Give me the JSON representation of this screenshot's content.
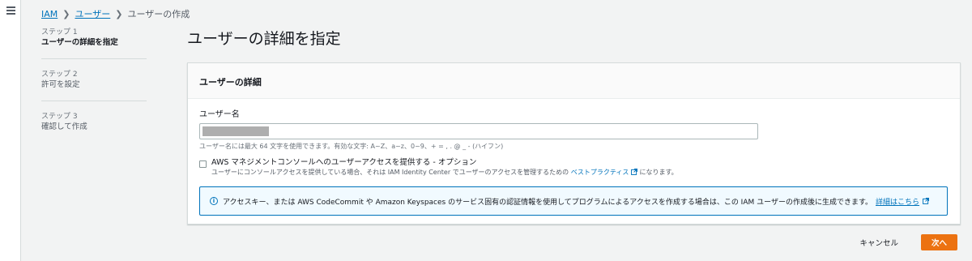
{
  "nav": {
    "menu_icon": "hamburger-menu-icon"
  },
  "breadcrumb": {
    "items": [
      "IAM",
      "ユーザー",
      "ユーザーの作成"
    ],
    "separator_icon": "chevron-right-icon"
  },
  "steps": [
    {
      "number": "ステップ 1",
      "title": "ユーザーの詳細を指定",
      "active": true
    },
    {
      "number": "ステップ 2",
      "title": "許可を設定",
      "active": false
    },
    {
      "number": "ステップ 3",
      "title": "確認して作成",
      "active": false
    }
  ],
  "page": {
    "title": "ユーザーの詳細を指定"
  },
  "panel": {
    "header": "ユーザーの詳細",
    "username_label": "ユーザー名",
    "username_value": "",
    "username_hint": "ユーザー名には最大 64 文字を使用できます。有効な文字: A~Z、a~z、0~9、+ = , . @ _ - (ハイフン)",
    "console_access": {
      "checked": false,
      "label": "AWS マネジメントコンソールへのユーザーアクセスを提供する - オプション",
      "desc_prefix": "ユーザーにコンソールアクセスを提供している場合、それは IAM Identity Center でユーザーのアクセスを管理するための",
      "desc_link": "ベストプラクティス",
      "desc_suffix": "になります。"
    },
    "info": {
      "icon": "info-icon",
      "text": "アクセスキー、または AWS CodeCommit や Amazon Keyspaces のサービス固有の認証情報を使用してプログラムによるアクセスを作成する場合は、この IAM ユーザーの作成後に生成できます。",
      "link": "詳細はこちら"
    }
  },
  "actions": {
    "cancel": "キャンセル",
    "next": "次へ"
  },
  "colors": {
    "accent": "#ec7211",
    "link": "#0073bb",
    "info_border": "#0073bb",
    "info_bg": "#f1faff"
  }
}
